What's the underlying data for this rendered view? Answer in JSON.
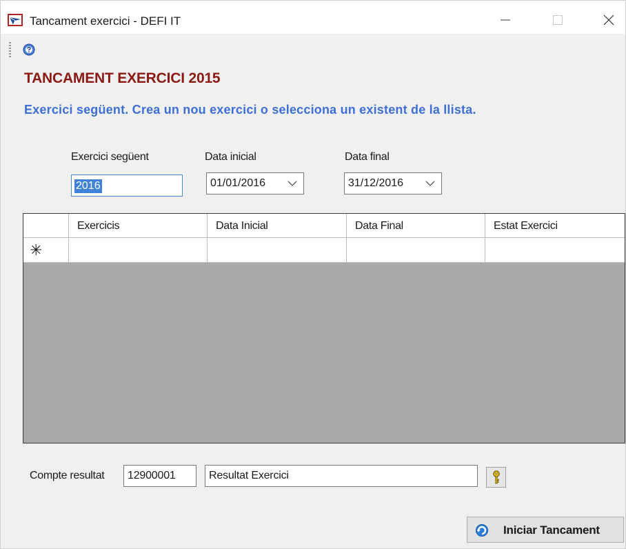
{
  "window": {
    "title": "Tancament exercici - DEFI IT"
  },
  "header": {
    "heading": "TANCAMENT EXERCICI 2015",
    "subheading": "Exercici següent. Crea un nou exercici o selecciona un existent de la llista."
  },
  "form": {
    "next_year_label": "Exercici següent",
    "next_year_value": "2016",
    "start_date_label": "Data inicial",
    "start_date_value": "01/01/2016",
    "end_date_label": "Data final",
    "end_date_value": "31/12/2016"
  },
  "grid": {
    "columns": [
      "Exercicis",
      "Data Inicial",
      "Data Final",
      "Estat Exercici"
    ],
    "new_row_marker": "✳",
    "rows": []
  },
  "footer": {
    "account_label": "Compte resultat",
    "account_value": "12900001",
    "description_value": "Resultat Exercici",
    "start_button_label": "Iniciar Tancament"
  },
  "colors": {
    "heading": "#8b1a14",
    "subheading": "#3d6fd6",
    "selection": "#3f83d8",
    "grid_background": "#a9a9a9"
  },
  "icons": {
    "app": "app-logo-icon",
    "help": "help-icon",
    "key": "key-icon",
    "start": "refresh-icon",
    "chevron": "chevron-down-icon"
  }
}
